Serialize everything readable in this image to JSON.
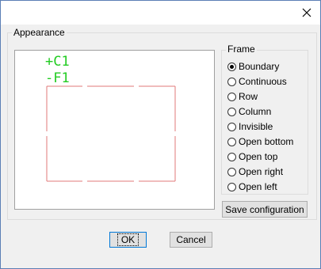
{
  "dialog": {
    "close_icon": "close-icon"
  },
  "appearance": {
    "group_label": "Appearance",
    "preview": {
      "label_top": "+C1",
      "label_bottom": "-F1",
      "frame_color": "#e0787a",
      "label_color": "#22cc22"
    }
  },
  "frame": {
    "group_label": "Frame",
    "options": [
      {
        "label": "Boundary",
        "selected": true
      },
      {
        "label": "Continuous",
        "selected": false
      },
      {
        "label": "Row",
        "selected": false
      },
      {
        "label": "Column",
        "selected": false
      },
      {
        "label": "Invisible",
        "selected": false
      },
      {
        "label": "Open bottom",
        "selected": false
      },
      {
        "label": "Open top",
        "selected": false
      },
      {
        "label": "Open right",
        "selected": false
      },
      {
        "label": "Open left",
        "selected": false
      }
    ]
  },
  "buttons": {
    "save_configuration": "Save configuration",
    "ok": "OK",
    "cancel": "Cancel"
  }
}
